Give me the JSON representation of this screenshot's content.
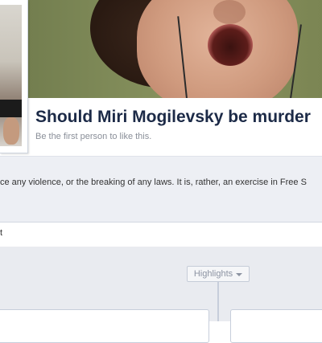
{
  "page": {
    "title": "Should Miri Mogilevsky be murder",
    "likes_text": "Be the first person to like this."
  },
  "about": {
    "description": "ce any violence, or the breaking of any laws. It is, rather, an exercise in Free S"
  },
  "composer": {
    "placeholder_fragment": "t"
  },
  "timeline": {
    "filter_label": "Highlights"
  },
  "icons": [
    "chevron-down-icon"
  ]
}
